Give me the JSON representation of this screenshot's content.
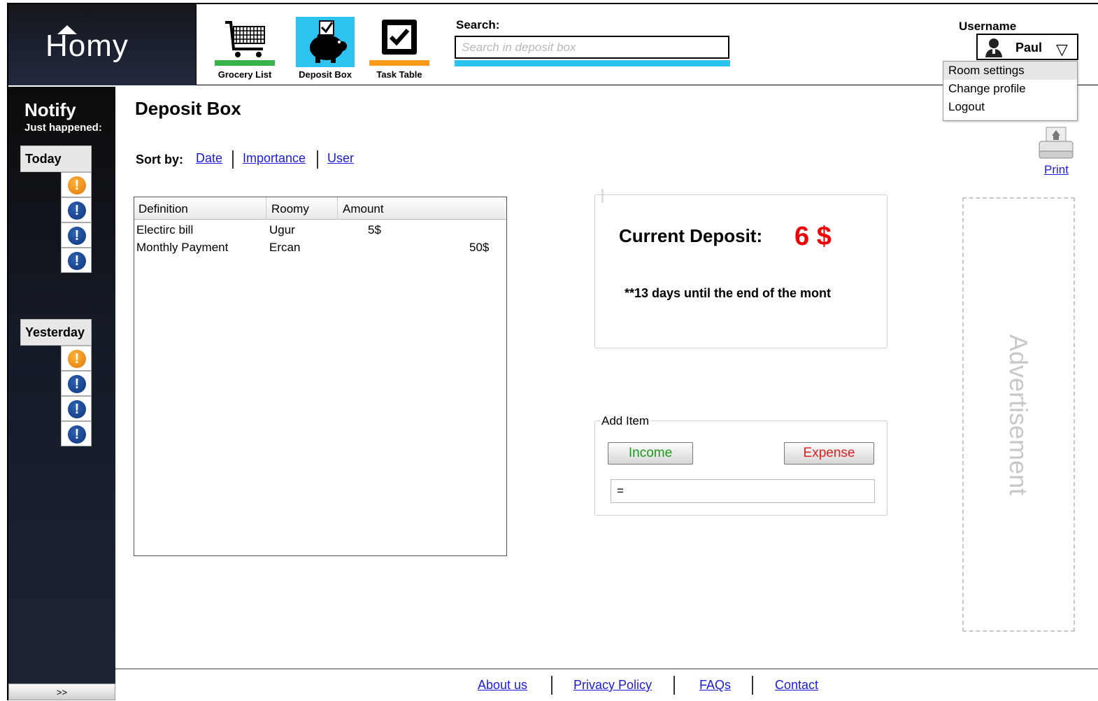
{
  "app": {
    "logo": "Homy"
  },
  "nav": [
    {
      "label": "Grocery List",
      "bar_color": "#36b44a"
    },
    {
      "label": "Deposit Box",
      "bar_color": "#2cc3f0"
    },
    {
      "label": "Task Table",
      "bar_color": "#f99a1c"
    }
  ],
  "search": {
    "label": "Search:",
    "placeholder": "Search in deposit box"
  },
  "user": {
    "label": "Username",
    "name": "Paul",
    "menu": [
      "Room settings",
      "Change profile",
      "Logout"
    ]
  },
  "sidebar": {
    "title": "Notify",
    "subtitle": "Just happened:",
    "groups": [
      {
        "label": "Today",
        "alerts": [
          "warning",
          "info",
          "info",
          "info"
        ]
      },
      {
        "label": "Yesterday",
        "alerts": [
          "warning",
          "info",
          "info",
          "info"
        ]
      }
    ],
    "expand": ">>"
  },
  "main": {
    "title": "Deposit Box",
    "sort_label": "Sort by:",
    "sort_options": [
      "Date",
      "Importance",
      "User"
    ]
  },
  "table": {
    "columns": [
      "Definition",
      "Roomy",
      "Amount"
    ],
    "rows": [
      {
        "definition": "Electirc bill",
        "roomy": "Ugur",
        "amount": "5$"
      },
      {
        "definition": "Monthly Payment",
        "roomy": "Ercan",
        "amount": "50$"
      }
    ]
  },
  "deposit": {
    "label": "Current Deposit:",
    "value": "6 $",
    "note": "**13 days until the end of the mont"
  },
  "add_item": {
    "legend": "Add Item",
    "income": "Income",
    "expense": "Expense",
    "input_value": "="
  },
  "print": {
    "label": "Print"
  },
  "ad": {
    "label": "Advertisement"
  },
  "footer": {
    "links": [
      "About us",
      "Privacy Policy",
      "FAQs",
      "Contact"
    ]
  },
  "colors": {
    "search_underline": "#2cc3f0",
    "deposit_value": "#f00000",
    "income": "#1a9a1a",
    "expense": "#e02020",
    "link": "#1a1ae6"
  }
}
